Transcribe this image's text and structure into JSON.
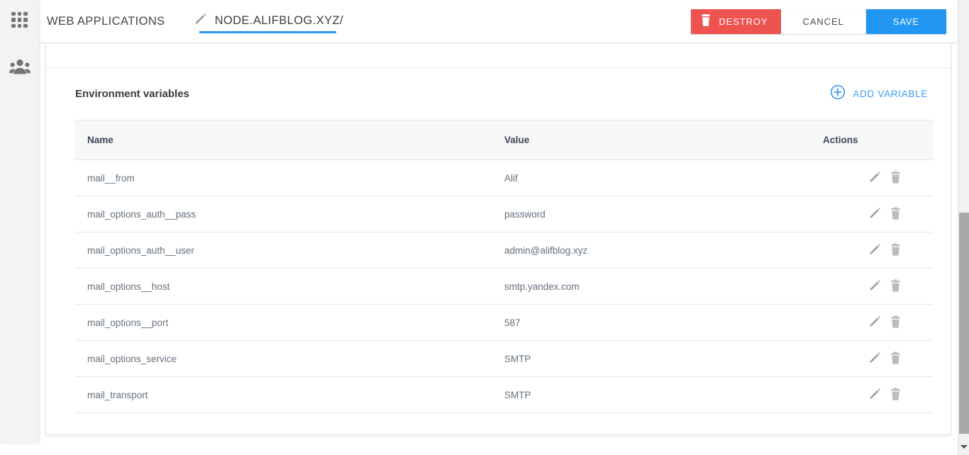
{
  "sidebar": {
    "items": [
      {
        "name": "apps-grid",
        "icon": "grid-icon"
      },
      {
        "name": "users-group",
        "icon": "people-icon"
      }
    ]
  },
  "header": {
    "breadcrumb": "WEB APPLICATIONS",
    "tab_label": "NODE.ALIFBLOG.XYZ/",
    "tab_edit_icon": "pencil-icon",
    "accent_color": "#2196f3",
    "buttons": {
      "destroy": "DESTROY",
      "destroy_icon": "trash-icon",
      "destroy_color": "#ef5350",
      "cancel": "CANCEL",
      "save": "SAVE",
      "save_color": "#2196f3"
    }
  },
  "main": {
    "section_title": "Environment variables",
    "add_variable": {
      "label": "ADD VARIABLE",
      "icon": "plus-circle-icon",
      "color": "#3d9bef"
    },
    "table": {
      "columns": [
        "Name",
        "Value",
        "Actions"
      ],
      "row_action_icons": [
        "pencil-icon",
        "trash-icon"
      ],
      "rows": [
        {
          "name": "mail__from",
          "value": "Alif"
        },
        {
          "name": "mail_options_auth__pass",
          "value": "password"
        },
        {
          "name": "mail_options_auth__user",
          "value": "admin@alifblog.xyz"
        },
        {
          "name": "mail_options__host",
          "value": "smtp.yandex.com"
        },
        {
          "name": "mail_options__port",
          "value": "587"
        },
        {
          "name": "mail_options_service",
          "value": "SMTP"
        },
        {
          "name": "mail_transport",
          "value": "SMTP"
        }
      ]
    }
  },
  "scrollbar": {
    "down_arrow_icon": "caret-down-icon"
  }
}
